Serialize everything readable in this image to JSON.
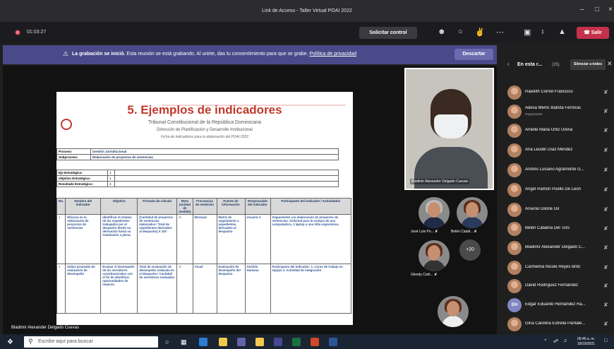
{
  "window": {
    "title": "Link de Acceso - Taller Virtual POAI 2022",
    "minimize": "–",
    "maximize": "□",
    "close": "×"
  },
  "toolbar": {
    "timer": "01:03:27",
    "request_control": "Solicitar control",
    "leave": "Salir"
  },
  "banner": {
    "bold": "La grabación se inició.",
    "text": "Esta reunión se está grabando. Al unirte, das tu consentimiento para que se grabe.",
    "link": "Política de privacidad",
    "dismiss": "Descartar"
  },
  "shared_doc": {
    "heading": "5. Ejemplos de indicadores",
    "sub1": "Tribunal Constitucional de la República Dominicana",
    "sub2": "Dirección de Planificación y Desarrollo Institucional",
    "sub3": "Ficha de indicadores para la elaboración del POAI 2022",
    "proceso_label": "Proceso:",
    "proceso_value": "Gestión Jurisdiccional",
    "subproceso_label": "Subproceso:",
    "subproceso_value": "Elaboración de proyectos de sentencias",
    "eje_label": "Eje Estratégico:",
    "eje_value": "1",
    "objetivo_label": "Objetivo Estratégico:",
    "objetivo_value": "1",
    "resultado_label": "Resultado Estratégico:",
    "resultado_value": "2",
    "headers": [
      "No.",
      "Nombre del indicador",
      "Objetivo",
      "Fórmula de cálculo",
      "Meta (unidad de medida)",
      "Frecuencia de medición",
      "Fuente de información",
      "Responsable del indicador",
      "Participante del indicador / Actividades"
    ],
    "rows": [
      [
        "1",
        "Eficacia en la elaboración de proyectos de sentencias",
        "Identificar el estatus de los expedientes trabajados por el despacho desde su derivación hasta su tramitación a pleno.",
        "(Cantidad de proyectos de sentencias elaborados / Total de expedientes derivados al despacho) X 100",
        "%",
        "Mensual",
        "Matriz de seguimiento a expedientes derivados al despacho",
        "Usuario A",
        "Seguimiento a la elaboración de proyectos de sentencias. Solicitud para la compra de una computadora, 1 laptop y una Silla ergonómica."
      ],
      [
        "2",
        "Índice promedio de evaluación de desempeño",
        "Evaluar el desempeño de los servidores constitucionales con el fin de identificar oportunidades de mejoras.",
        "Total de evaluación de desempeño realizada en el despacho / Cantidad de servidores evaluados",
        "%",
        "Anual",
        "Evaluación de desempeño del despacho",
        "Gestión Humana",
        "Participante del indicador: 1. Curso de trabajo en equipo 2. Actividad de integración"
      ]
    ]
  },
  "sharer_name": "Bladimir Alexander Delgado Cuevas",
  "main_tile_name": "Bladimir Alexander Delgado Cuevas",
  "tiles": {
    "t1": "José Luis Po...",
    "t2": "Belén Catali...",
    "t3": "Glendy Carli...",
    "more": "+20"
  },
  "panel": {
    "title": "En esta r...",
    "count": "(25)",
    "mute_all": "Silenciar a todos",
    "people": [
      {
        "name": "Raedith Cornel Francisco",
        "role": ""
      },
      {
        "name": "Adesa Merlic Batista Ferreras",
        "role": "Organizador"
      },
      {
        "name": "Amelle Maria Ortiz Ureña",
        "role": ""
      },
      {
        "name": "Ana Leudin Díaz Méndez",
        "role": ""
      },
      {
        "name": "Andrés Luciano Agramonte G...",
        "role": ""
      },
      {
        "name": "Ángel Ramón Puello De León",
        "role": ""
      },
      {
        "name": "Arsenio Diloné Gil",
        "role": ""
      },
      {
        "name": "Belén Catalina Del Toro",
        "role": ""
      },
      {
        "name": "Bladimir Alexander Delgado C...",
        "role": ""
      },
      {
        "name": "Carmelina Nicole Reyes Brito",
        "role": ""
      },
      {
        "name": "David Rodríguez Fernández",
        "role": ""
      },
      {
        "name": "Edgar Eduardo Hernández Ra...",
        "role": "",
        "initials": "EH"
      },
      {
        "name": "Gina Carolina Estrella Pantale...",
        "role": ""
      }
    ]
  },
  "taskbar": {
    "search_placeholder": "Escribe aquí para buscar",
    "time": "09:46 a. m.",
    "date": "18/10/2021"
  },
  "colors": {
    "banner": "#4a4a8a",
    "leave": "#c4314b",
    "doc_heading": "#c0392b"
  }
}
